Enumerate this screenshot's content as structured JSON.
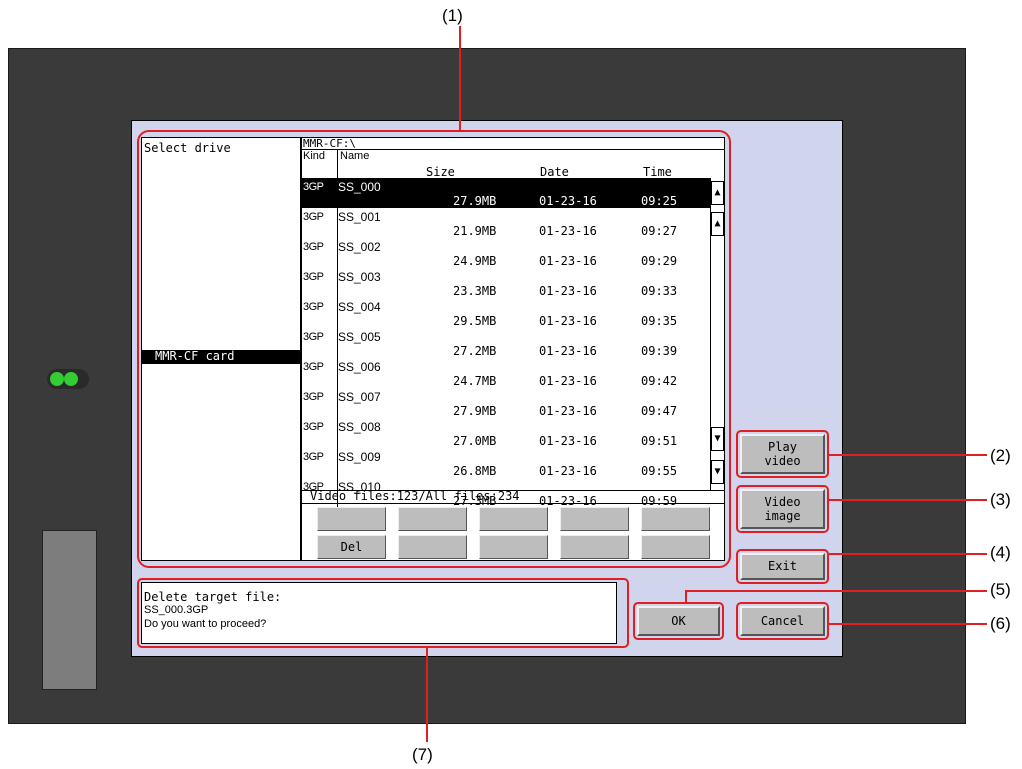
{
  "callouts": [
    "(1)",
    "(2)",
    "(3)",
    "(4)",
    "(5)",
    "(6)",
    "(7)"
  ],
  "left_pane": {
    "title": "Select drive",
    "selected_drive": "MMR-CF card"
  },
  "file_list": {
    "path": "MMR-CF:\\",
    "headers": {
      "kind": "Kind",
      "name": "Name",
      "size": "Size",
      "date": "Date",
      "time": "Time"
    },
    "rows": [
      {
        "kind": "3GP",
        "name": "SS_000",
        "size": "27.9MB",
        "date": "01-23-16",
        "time": "09:25",
        "selected": true
      },
      {
        "kind": "3GP",
        "name": "SS_001",
        "size": "21.9MB",
        "date": "01-23-16",
        "time": "09:27"
      },
      {
        "kind": "3GP",
        "name": "SS_002",
        "size": "24.9MB",
        "date": "01-23-16",
        "time": "09:29"
      },
      {
        "kind": "3GP",
        "name": "SS_003",
        "size": "23.3MB",
        "date": "01-23-16",
        "time": "09:33"
      },
      {
        "kind": "3GP",
        "name": "SS_004",
        "size": "29.5MB",
        "date": "01-23-16",
        "time": "09:35"
      },
      {
        "kind": "3GP",
        "name": "SS_005",
        "size": "27.2MB",
        "date": "01-23-16",
        "time": "09:39"
      },
      {
        "kind": "3GP",
        "name": "SS_006",
        "size": "24.7MB",
        "date": "01-23-16",
        "time": "09:42"
      },
      {
        "kind": "3GP",
        "name": "SS_007",
        "size": "27.9MB",
        "date": "01-23-16",
        "time": "09:47"
      },
      {
        "kind": "3GP",
        "name": "SS_008",
        "size": "27.0MB",
        "date": "01-23-16",
        "time": "09:51"
      },
      {
        "kind": "3GP",
        "name": "SS_009",
        "size": "26.8MB",
        "date": "01-23-16",
        "time": "09:55"
      },
      {
        "kind": "3GP",
        "name": "SS_010",
        "size": "27.3MB",
        "date": "01-23-16",
        "time": "09:59"
      }
    ],
    "summary": "Video files:123/All files:234"
  },
  "scroll": {
    "top_icon": "double-up-arrow-icon",
    "up_icon": "up-arrow-icon",
    "down_icon": "down-arrow-icon",
    "bottom_icon": "double-down-arrow-icon"
  },
  "buttons": {
    "del": "Del",
    "play_video_1": "Play",
    "play_video_2": "video",
    "video_image_1": "Video",
    "video_image_2": "image",
    "exit": "Exit",
    "ok": "OK",
    "cancel": "Cancel"
  },
  "message": {
    "line1": "Delete target file:",
    "line2": " SS_000.3GP",
    "line3": "Do you want to proceed?"
  },
  "colors": {
    "callout": "#e02020",
    "screen_bg": "#d0d4ec",
    "bezel": "#3a3a3a",
    "led": "#33cc33"
  }
}
